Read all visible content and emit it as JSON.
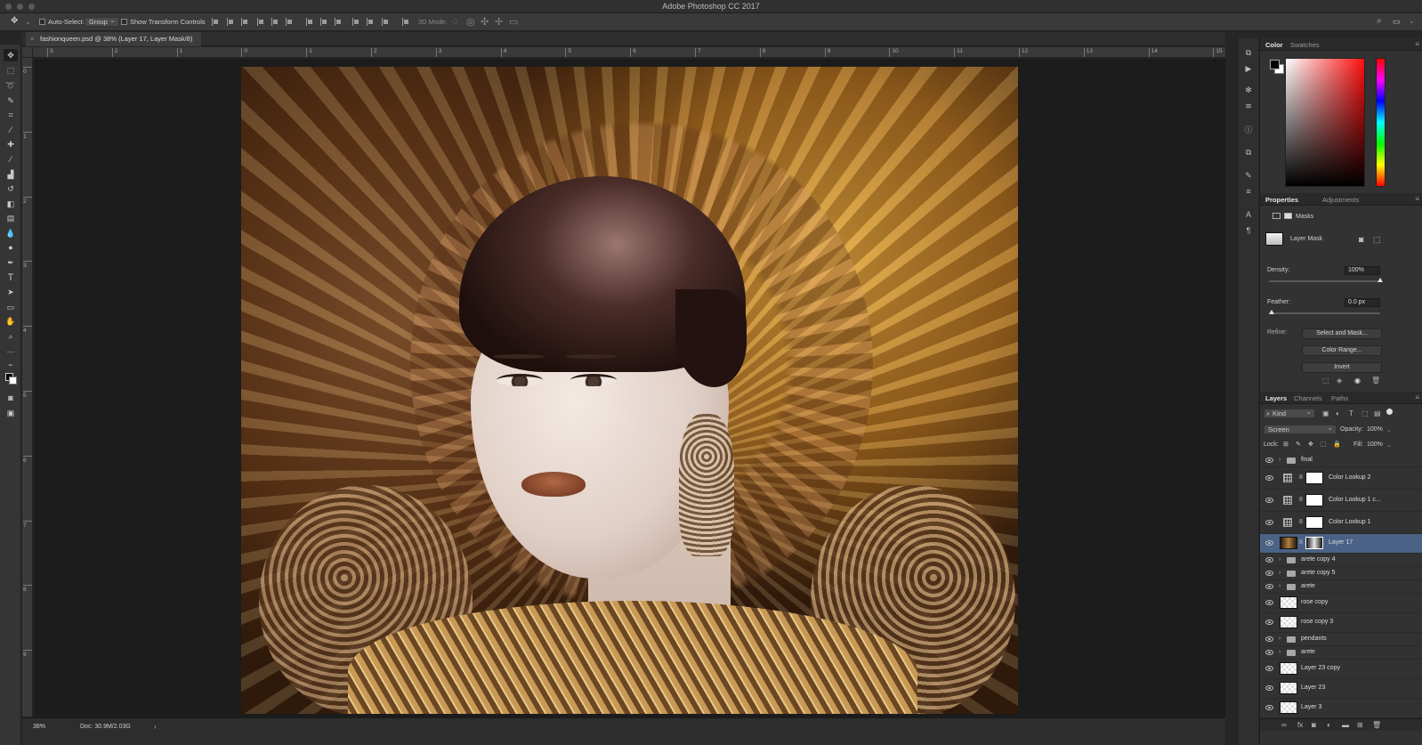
{
  "window": {
    "title": "Adobe Photoshop CC 2017"
  },
  "options_bar": {
    "auto_select_label": "Auto-Select:",
    "auto_select_value": "Group",
    "show_transform_label": "Show Transform Controls",
    "mode_3d_label": "3D Mode:"
  },
  "document": {
    "tab_title": "fashionqueen.psd @ 38% (Layer 17, Layer Mask/8)",
    "ruler_h": [
      "3",
      "2",
      "1",
      "0",
      "1",
      "2",
      "3",
      "4",
      "5",
      "6",
      "7",
      "8",
      "9",
      "10",
      "11",
      "12",
      "13",
      "14",
      "15"
    ],
    "ruler_v": [
      "0",
      "1",
      "2",
      "3",
      "4",
      "5",
      "6",
      "7",
      "8",
      "9"
    ]
  },
  "status": {
    "zoom": "38%",
    "doc": "Doc: 30.9M/2.03G"
  },
  "color_panel": {
    "tabs": [
      "Color",
      "Swatches"
    ],
    "active": "Color"
  },
  "properties_panel": {
    "tabs": [
      "Properties",
      "Adjustments"
    ],
    "active": "Properties",
    "section": "Masks",
    "mask_label": "Layer Mask",
    "density_label": "Density:",
    "density_value": "100%",
    "density_fraction": 1.0,
    "feather_label": "Feather:",
    "feather_value": "0.0 px",
    "feather_fraction": 0.0,
    "refine_label": "Refine:",
    "buttons": [
      "Select and Mask...",
      "Color Range...",
      "Invert"
    ]
  },
  "layers_panel": {
    "tabs": [
      "Layers",
      "Channels",
      "Paths"
    ],
    "active": "Layers",
    "kind_label": "Kind",
    "blend_mode": "Screen",
    "opacity_label": "Opacity:",
    "opacity_value": "100%",
    "lock_label": "Lock:",
    "fill_label": "Fill:",
    "fill_value": "100%",
    "layers": [
      {
        "name": "final",
        "type": "group"
      },
      {
        "name": "Color Lookup 2",
        "type": "adjustment"
      },
      {
        "name": "Color Lookup 1 c...",
        "type": "adjustment"
      },
      {
        "name": "Color Lookup 1",
        "type": "adjustment"
      },
      {
        "name": "Layer 17",
        "type": "image-mask",
        "selected": true
      },
      {
        "name": "arete copy 4",
        "type": "group"
      },
      {
        "name": "arete copy 5",
        "type": "group"
      },
      {
        "name": "arete",
        "type": "group"
      },
      {
        "name": "rose copy",
        "type": "pixel"
      },
      {
        "name": "rose copy 3",
        "type": "pixel"
      },
      {
        "name": "pendants",
        "type": "group"
      },
      {
        "name": "arete",
        "type": "group"
      },
      {
        "name": "Layer 23 copy",
        "type": "pixel"
      },
      {
        "name": "Layer 23",
        "type": "pixel"
      },
      {
        "name": "Layer 3",
        "type": "pixel"
      }
    ]
  },
  "icons": {
    "tools": [
      "move-icon",
      "marquee-icon",
      "lasso-icon",
      "quick-select-icon",
      "crop-icon",
      "eyedropper-icon",
      "healing-icon",
      "brush-icon",
      "stamp-icon",
      "history-brush-icon",
      "eraser-icon",
      "gradient-icon",
      "blur-icon",
      "dodge-icon",
      "pen-icon",
      "type-icon",
      "path-select-icon",
      "rectangle-icon",
      "hand-icon",
      "zoom-icon",
      "more-tools-icon"
    ]
  }
}
